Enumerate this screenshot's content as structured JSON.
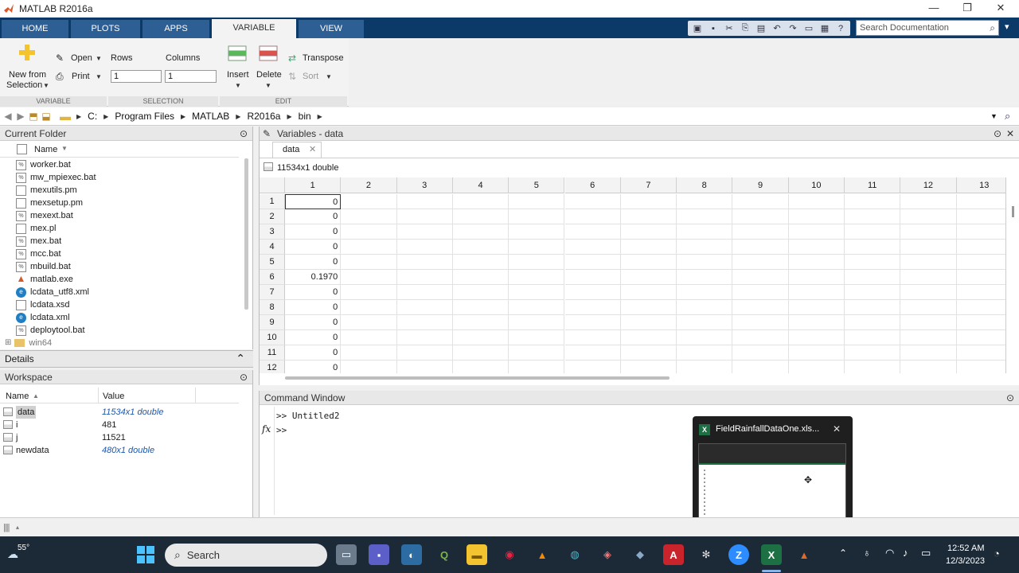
{
  "window": {
    "title": "MATLAB R2016a",
    "minimize": "—",
    "maximize": "❐",
    "close": "✕"
  },
  "tabs": [
    {
      "label": "HOME"
    },
    {
      "label": "PLOTS"
    },
    {
      "label": "APPS"
    },
    {
      "label": "VARIABLE",
      "active": true
    },
    {
      "label": "VIEW"
    }
  ],
  "search_doc": {
    "placeholder": "Search Documentation"
  },
  "ribbon": {
    "new_from_selection_line1": "New from",
    "new_from_selection_line2": "Selection",
    "open": "Open",
    "print": "Print",
    "rows_label": "Rows",
    "columns_label": "Columns",
    "rows_value": "1",
    "columns_value": "1",
    "insert": "Insert",
    "delete": "Delete",
    "transpose": "Transpose",
    "sort": "Sort",
    "group_variable": "VARIABLE",
    "group_selection": "SELECTION",
    "group_edit": "EDIT"
  },
  "address": {
    "crumbs": [
      "C:",
      "Program Files",
      "MATLAB",
      "R2016a",
      "bin"
    ]
  },
  "current_folder": {
    "title": "Current Folder",
    "name_header": "Name",
    "files": [
      {
        "name": "worker.bat",
        "kind": "bat"
      },
      {
        "name": "mw_mpiexec.bat",
        "kind": "bat"
      },
      {
        "name": "mexutils.pm",
        "kind": "file"
      },
      {
        "name": "mexsetup.pm",
        "kind": "file"
      },
      {
        "name": "mexext.bat",
        "kind": "bat"
      },
      {
        "name": "mex.pl",
        "kind": "file"
      },
      {
        "name": "mex.bat",
        "kind": "bat"
      },
      {
        "name": "mcc.bat",
        "kind": "bat"
      },
      {
        "name": "mbuild.bat",
        "kind": "bat"
      },
      {
        "name": "matlab.exe",
        "kind": "exe"
      },
      {
        "name": "lcdata_utf8.xml",
        "kind": "xml"
      },
      {
        "name": "lcdata.xsd",
        "kind": "file"
      },
      {
        "name": "lcdata.xml",
        "kind": "xml"
      },
      {
        "name": "deploytool.bat",
        "kind": "bat"
      },
      {
        "name": "win64",
        "kind": "folder"
      }
    ]
  },
  "details": {
    "title": "Details"
  },
  "workspace": {
    "title": "Workspace",
    "col_name": "Name",
    "col_value": "Value",
    "vars": [
      {
        "name": "data",
        "value": "11534x1 double",
        "italic": true
      },
      {
        "name": "i",
        "value": "481",
        "italic": false
      },
      {
        "name": "j",
        "value": "11521",
        "italic": false
      },
      {
        "name": "newdata",
        "value": "480x1 double",
        "italic": true
      }
    ]
  },
  "variables": {
    "title": "Variables - data",
    "tab": "data",
    "size_label": "11534x1 double",
    "col_headers": [
      "1",
      "2",
      "3",
      "4",
      "5",
      "6",
      "7",
      "8",
      "9",
      "10",
      "11",
      "12",
      "13"
    ],
    "row_headers": [
      "1",
      "2",
      "3",
      "4",
      "5",
      "6",
      "7",
      "8",
      "9",
      "10",
      "11",
      "12"
    ],
    "col1_values": [
      "0",
      "0",
      "0",
      "0",
      "0",
      "0.1970",
      "0",
      "0",
      "0",
      "0",
      "0",
      "0"
    ]
  },
  "command_window": {
    "title": "Command Window",
    "line1": ">> Untitled2",
    "line2": ">>",
    "fx": "fx"
  },
  "thumbnail": {
    "title": "FieldRainfallDataOne.xls...",
    "close": "✕"
  },
  "taskbar": {
    "weather": "55°",
    "search": "Search",
    "time": "12:52 AM",
    "date": "12/3/2023"
  }
}
